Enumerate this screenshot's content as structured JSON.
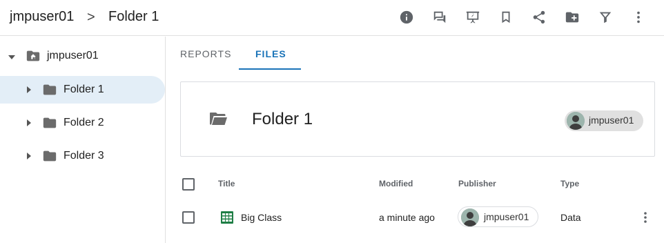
{
  "breadcrumb": {
    "root": "jmpuser01",
    "separator": ">",
    "current": "Folder 1"
  },
  "header_icons": [
    "info-icon",
    "comments-icon",
    "present-icon",
    "bookmark-icon",
    "share-icon",
    "new-folder-icon",
    "filter-icon",
    "more-vert-icon"
  ],
  "tree": {
    "root": {
      "label": "jmpuser01",
      "icon": "home-folder-icon"
    },
    "items": [
      {
        "label": "Folder 1",
        "selected": true
      },
      {
        "label": "Folder 2",
        "selected": false
      },
      {
        "label": "Folder 3",
        "selected": false
      }
    ]
  },
  "tabs": [
    {
      "label": "REPORTS",
      "active": false
    },
    {
      "label": "FILES",
      "active": true
    }
  ],
  "folder_card": {
    "title": "Folder 1",
    "owner": "jmpuser01"
  },
  "table": {
    "columns": [
      "Title",
      "Modified",
      "Publisher",
      "Type"
    ],
    "rows": [
      {
        "title": "Big Class",
        "modified": "a minute ago",
        "publisher": "jmpuser01",
        "type": "Data"
      }
    ]
  },
  "colors": {
    "accent": "#1a73b8",
    "selected_bg": "#e3eef7",
    "sheet_green": "#1e7e45"
  }
}
